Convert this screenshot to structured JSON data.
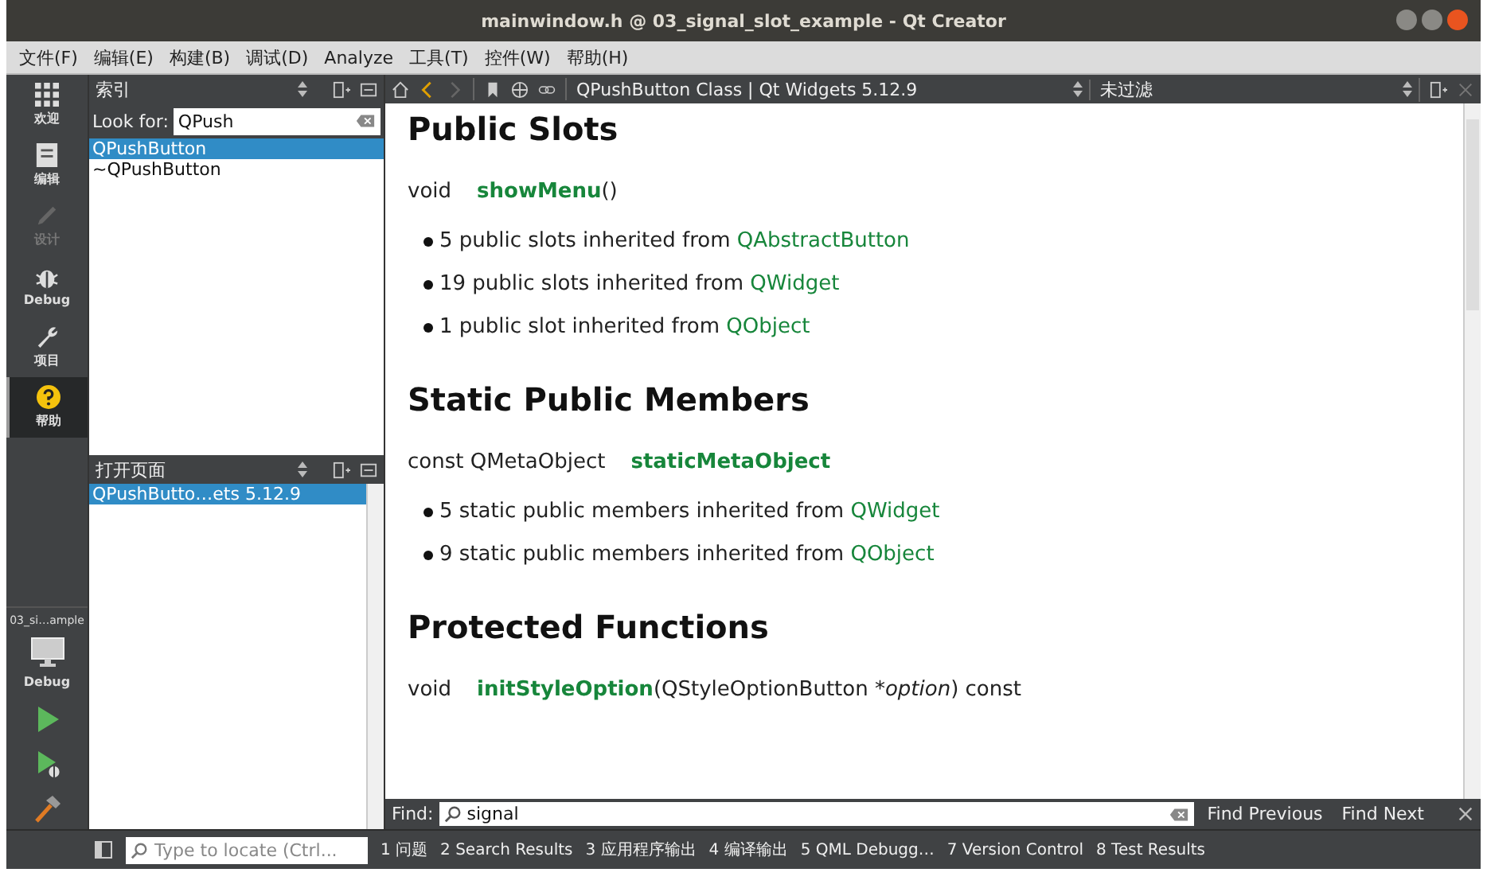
{
  "window": {
    "title": "mainwindow.h @ 03_signal_slot_example - Qt Creator"
  },
  "menu": [
    "文件(F)",
    "编辑(E)",
    "构建(B)",
    "调试(D)",
    "Analyze",
    "工具(T)",
    "控件(W)",
    "帮助(H)"
  ],
  "modes": [
    {
      "label": "欢迎",
      "kind": "grid",
      "selected": false,
      "disabled": false
    },
    {
      "label": "编辑",
      "kind": "doc",
      "selected": false,
      "disabled": false
    },
    {
      "label": "设计",
      "kind": "pen",
      "selected": false,
      "disabled": true
    },
    {
      "label": "Debug",
      "kind": "bug",
      "selected": false,
      "disabled": false
    },
    {
      "label": "项目",
      "kind": "wrench",
      "selected": false,
      "disabled": false
    },
    {
      "label": "帮助",
      "kind": "help",
      "selected": true,
      "disabled": false
    }
  ],
  "kit": {
    "project": "03_si…ample",
    "build": "Debug"
  },
  "index_pane": {
    "title": "索引",
    "look_for_label": "Look for:",
    "query": "QPush",
    "results": [
      {
        "text": "QPushButton",
        "selected": true
      },
      {
        "text": "~QPushButton",
        "selected": false
      }
    ]
  },
  "open_pages": {
    "title": "打开页面",
    "pages": [
      {
        "text": "QPushButto…ets 5.12.9",
        "selected": true
      }
    ]
  },
  "doc_toolbar": {
    "page": "QPushButton Class | Qt Widgets 5.12.9",
    "filter": "未过滤"
  },
  "sections": [
    {
      "heading": "Public Slots",
      "member": {
        "prefix": "void",
        "name": "showMenu",
        "args_before": "()"
      },
      "inherited": [
        {
          "text": "5 public slots inherited from ",
          "link": "QAbstractButton"
        },
        {
          "text": "19 public slots inherited from ",
          "link": "QWidget"
        },
        {
          "text": "1 public slot inherited from ",
          "link": "QObject"
        }
      ]
    },
    {
      "heading": "Static Public Members",
      "member": {
        "prefix": "const QMetaObject",
        "name": "staticMetaObject"
      },
      "inherited": [
        {
          "text": "5 static public members inherited from ",
          "link": "QWidget"
        },
        {
          "text": "9 static public members inherited from ",
          "link": "QObject"
        }
      ]
    },
    {
      "heading": "Protected Functions",
      "member": {
        "prefix": "void",
        "name": "initStyleOption",
        "args_before": "(QStyleOptionButton *",
        "arg_italic": "option",
        "args_after": ") const"
      }
    }
  ],
  "find_bar": {
    "label": "Find:",
    "query": "signal",
    "buttons": [
      "Find Previous",
      "Find Next"
    ]
  },
  "status_bar": {
    "locate_placeholder": "Type to locate (Ctrl...",
    "tabs": [
      "1 问题",
      "2 Search Results",
      "3 应用程序输出",
      "4 编译输出",
      "5 QML Debugg…",
      "7 Version Control",
      "8 Test Results"
    ]
  }
}
